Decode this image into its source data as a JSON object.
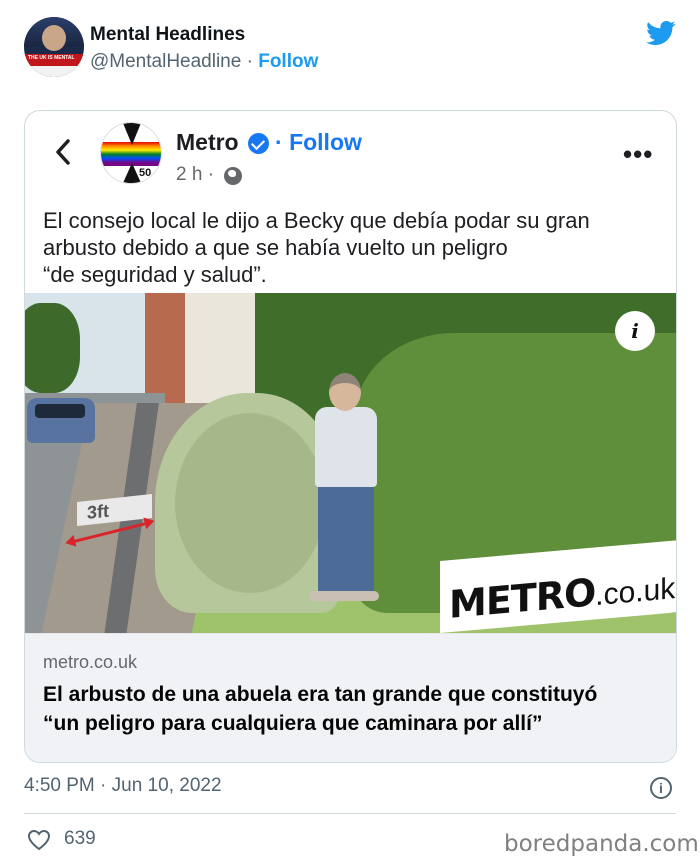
{
  "tweet": {
    "display_name": "Mental Headlines",
    "handle": "@MentalHeadline",
    "separator": " · ",
    "follow_label": "Follow",
    "avatar_banner": "THE UK IS MENTAL",
    "timestamp": "4:50 PM · Jun 10, 2022",
    "like_count": "639"
  },
  "embed": {
    "page_name": "Metro",
    "follow_separator": "·",
    "follow_label": "Follow",
    "age": "2 h ·",
    "logo_text": "50",
    "post_text_lines": [
      "El consejo local le dijo a Becky que debía podar su gran",
      "arbusto debido a que se había vuelto un peligro",
      "“de seguridad y salud”."
    ],
    "photo": {
      "info_label": "i",
      "measure_label": "3ft",
      "watermark_bold": "METRO",
      "watermark_suffix": ".co.uk"
    },
    "link_domain": "metro.co.uk",
    "link_headline_lines": [
      "El arbusto de una abuela era tan grande que constituyó",
      "“un peligro para cualquiera que caminara por allí”"
    ]
  },
  "source_watermark": "boredpanda.com",
  "colors": {
    "twitter_blue": "#1d9bf0",
    "facebook_blue": "#1877f2",
    "muted_text": "#536471"
  }
}
